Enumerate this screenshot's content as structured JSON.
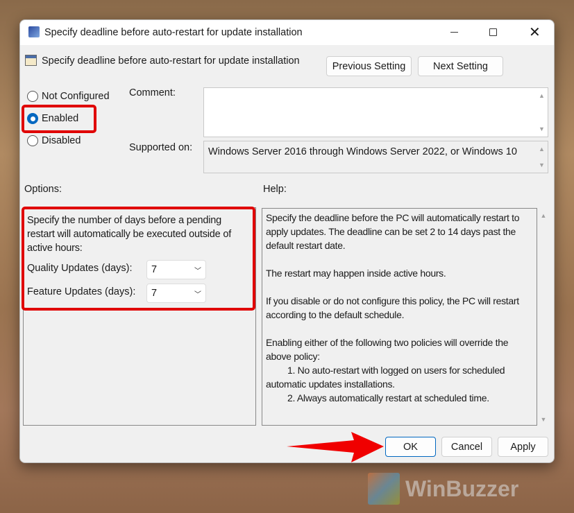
{
  "window": {
    "title": "Specify deadline before auto-restart for update installation"
  },
  "header": {
    "policy_name": "Specify deadline before auto-restart for update installation",
    "previous_label": "Previous Setting",
    "next_label": "Next Setting"
  },
  "state": {
    "options": [
      {
        "label": "Not Configured",
        "selected": false
      },
      {
        "label": "Enabled",
        "selected": true
      },
      {
        "label": "Disabled",
        "selected": false
      }
    ]
  },
  "comment": {
    "label": "Comment:",
    "value": ""
  },
  "supported": {
    "label": "Supported on:",
    "value": "Windows Server 2016 through Windows Server 2022, or Windows 10"
  },
  "options_panel": {
    "label": "Options:",
    "description": "Specify the number of days before a pending restart will automatically be executed outside of active hours:",
    "quality_label": "Quality Updates (days):",
    "quality_value": "7",
    "feature_label": "Feature Updates (days):",
    "feature_value": "7"
  },
  "help_panel": {
    "label": "Help:",
    "paragraphs": [
      "Specify the deadline before the PC will automatically restart to apply updates. The deadline can be set 2 to 14 days past the default restart date.",
      "The restart may happen inside active hours.",
      "If you disable or do not configure this policy, the PC will restart according to the default schedule.",
      "Enabling either of the following two policies will override the above policy:",
      "    1. No auto-restart with logged on users for scheduled automatic updates installations.",
      "    2. Always automatically restart at scheduled time."
    ]
  },
  "footer": {
    "ok": "OK",
    "cancel": "Cancel",
    "apply": "Apply"
  },
  "watermark": "WinBuzzer",
  "colors": {
    "accent": "#0067c0",
    "highlight": "#e00000"
  }
}
